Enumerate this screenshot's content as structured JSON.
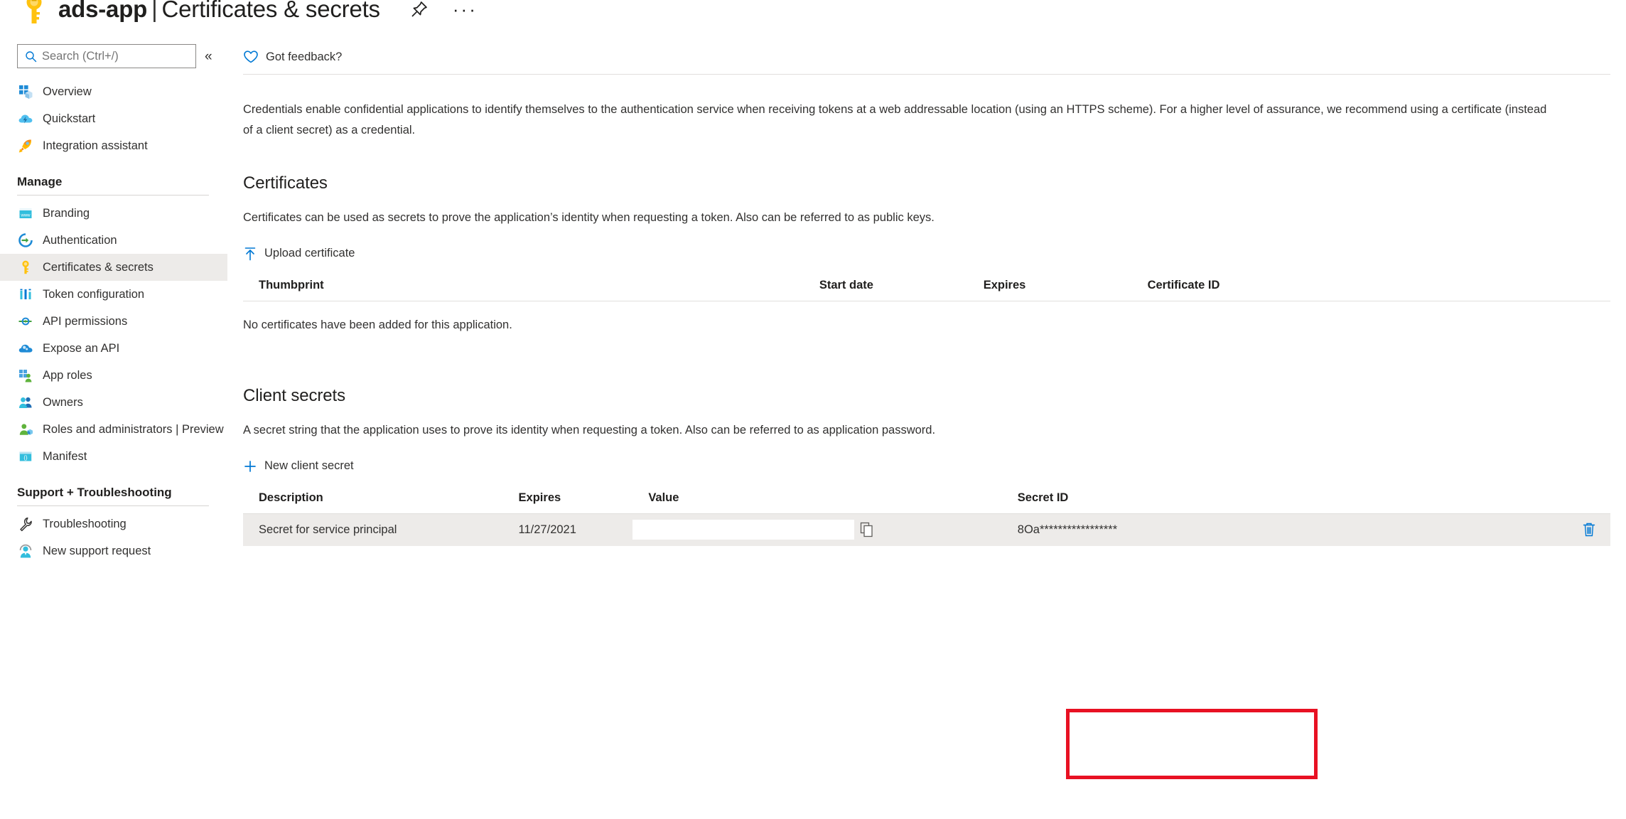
{
  "header": {
    "app_name": "ads-app",
    "separator": "|",
    "page_title": "Certificates & secrets",
    "pin_icon": "pin-icon",
    "more_label": "···"
  },
  "sidebar": {
    "search": {
      "placeholder": "Search (Ctrl+/)",
      "value": "",
      "icon": "search-icon"
    },
    "collapse_label": "«",
    "top_items": [
      {
        "label": "Overview",
        "icon": "overview-icon"
      },
      {
        "label": "Quickstart",
        "icon": "quickstart-cloud-icon"
      },
      {
        "label": "Integration assistant",
        "icon": "rocket-icon"
      }
    ],
    "groups": [
      {
        "title": "Manage",
        "items": [
          {
            "label": "Branding",
            "icon": "branding-www-icon",
            "selected": false
          },
          {
            "label": "Authentication",
            "icon": "authentication-arrow-icon",
            "selected": false
          },
          {
            "label": "Certificates & secrets",
            "icon": "key-icon",
            "selected": true
          },
          {
            "label": "Token configuration",
            "icon": "token-bars-icon",
            "selected": false
          },
          {
            "label": "API permissions",
            "icon": "api-permissions-icon",
            "selected": false
          },
          {
            "label": "Expose an API",
            "icon": "expose-api-cloud-icon",
            "selected": false
          },
          {
            "label": "App roles",
            "icon": "app-roles-icon",
            "selected": false
          },
          {
            "label": "Owners",
            "icon": "owners-people-icon",
            "selected": false
          },
          {
            "label": "Roles and administrators | Preview",
            "icon": "roles-admin-icon",
            "selected": false
          },
          {
            "label": "Manifest",
            "icon": "manifest-braces-icon",
            "selected": false
          }
        ]
      },
      {
        "title": "Support + Troubleshooting",
        "items": [
          {
            "label": "Troubleshooting",
            "icon": "wrench-icon",
            "selected": false
          },
          {
            "label": "New support request",
            "icon": "support-agent-icon",
            "selected": false
          }
        ]
      }
    ]
  },
  "command_bar": {
    "feedback_label": "Got feedback?",
    "feedback_icon": "heart-icon"
  },
  "main": {
    "intro": "Credentials enable confidential applications to identify themselves to the authentication service when receiving tokens at a web addressable location (using an HTTPS scheme). For a higher level of assurance, we recommend using a certificate (instead of a client secret) as a credential.",
    "certificates": {
      "heading": "Certificates",
      "description": "Certificates can be used as secrets to prove the application’s identity when requesting a token. Also can be referred to as public keys.",
      "upload_label": "Upload certificate",
      "upload_icon": "upload-arrow-icon",
      "columns": [
        "Thumbprint",
        "Start date",
        "Expires",
        "Certificate ID"
      ],
      "rows": [],
      "empty_message": "No certificates have been added for this application."
    },
    "client_secrets": {
      "heading": "Client secrets",
      "description": "A secret string that the application uses to prove its identity when requesting a token. Also can be referred to as application password.",
      "new_secret_label": "New client secret",
      "new_secret_icon": "plus-icon",
      "columns": [
        "Description",
        "Expires",
        "Value",
        "Secret ID"
      ],
      "rows": [
        {
          "description": "Secret for service principal",
          "expires": "11/27/2021",
          "value": "",
          "value_placeholder": "",
          "copy_icon": "copy-icon",
          "secret_id": "8Oa*****************",
          "delete_icon": "trash-icon"
        }
      ]
    }
  },
  "annotation": {
    "type": "rectangle-highlight",
    "target": "client-secret-value-cell",
    "color": "#e81123"
  }
}
